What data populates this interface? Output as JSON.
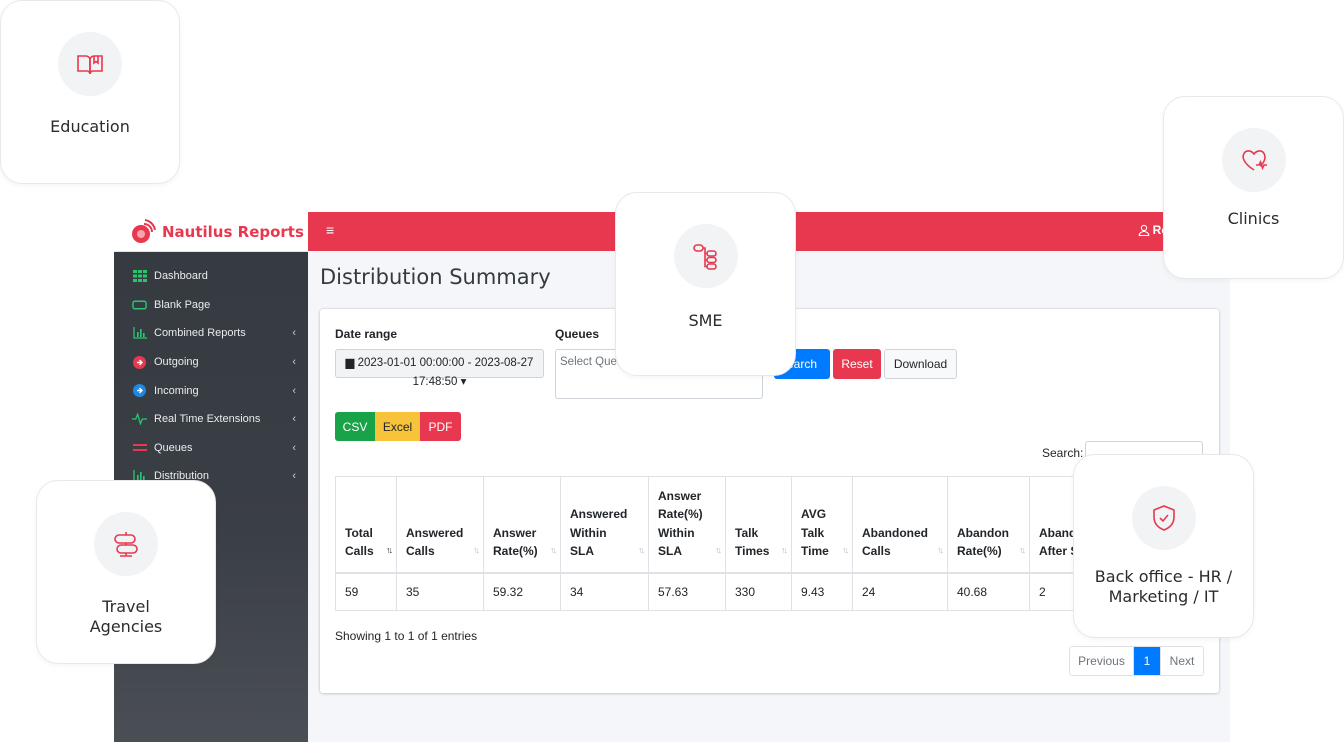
{
  "brand": {
    "name": "Nautilus Reports"
  },
  "colors": {
    "accent": "#e8384f",
    "primary": "#007bff",
    "success": "#18a349",
    "warning": "#f7c33a",
    "sidebar": "#343a40"
  },
  "sidebar": {
    "items": [
      {
        "label": "Dashboard",
        "icon": "grid-icon",
        "chevron": ""
      },
      {
        "label": "Blank Page",
        "icon": "rectangle-icon",
        "chevron": ""
      },
      {
        "label": "Combined Reports",
        "icon": "bar-chart-icon",
        "chevron": "‹"
      },
      {
        "label": "Outgoing",
        "icon": "arrow-circle-icon",
        "chevron": "‹"
      },
      {
        "label": "Incoming",
        "icon": "arrow-circle-icon",
        "chevron": "‹"
      },
      {
        "label": "Real Time Extensions",
        "icon": "pulse-icon",
        "chevron": "‹"
      },
      {
        "label": "Queues",
        "icon": "equals-icon",
        "chevron": "‹"
      },
      {
        "label": "Distribution",
        "icon": "bar-chart-icon",
        "chevron": "‹"
      }
    ]
  },
  "topbar": {
    "menu_icon": "≡",
    "user_text": "Re"
  },
  "page": {
    "title": "Distribution Summary"
  },
  "filters": {
    "date_label": "Date range",
    "date_value_line1": "2023-01-01 00:00:00 - 2023-08-27",
    "date_value_line2": "17:48:50",
    "queues_label": "Queues",
    "queues_placeholder": "Select Queu"
  },
  "buttons": {
    "search": "earch",
    "reset": "Reset",
    "download": "Download"
  },
  "export": {
    "csv": "CSV",
    "excel": "Excel",
    "pdf": "PDF"
  },
  "table": {
    "search_label": "Search:",
    "headers": [
      {
        "lines": [
          "Total",
          "Calls"
        ],
        "width": 61,
        "sort": "asc"
      },
      {
        "lines": [
          "Answered",
          "Calls"
        ],
        "width": 87,
        "sort": "none"
      },
      {
        "lines": [
          "Answer",
          "Rate(%)"
        ],
        "width": 77,
        "sort": "none"
      },
      {
        "lines": [
          "Answered",
          "Within",
          "SLA"
        ],
        "width": 88,
        "sort": "none"
      },
      {
        "lines": [
          "Answer",
          "Rate(%)",
          "Within",
          "SLA"
        ],
        "width": 77,
        "sort": "none"
      },
      {
        "lines": [
          "Talk",
          "Times"
        ],
        "width": 66,
        "sort": "none"
      },
      {
        "lines": [
          "AVG",
          "Talk",
          "Time"
        ],
        "width": 61,
        "sort": "none"
      },
      {
        "lines": [
          "Abandoned",
          "Calls"
        ],
        "width": 95,
        "sort": "none"
      },
      {
        "lines": [
          "Abandon",
          "Rate(%)"
        ],
        "width": 82,
        "sort": "none"
      },
      {
        "lines": [
          "Aband",
          "After S"
        ],
        "width": 60,
        "sort": "none"
      }
    ],
    "rows": [
      [
        "59",
        "35",
        "59.32",
        "34",
        "57.63",
        "330",
        "9.43",
        "24",
        "40.68",
        "2"
      ]
    ],
    "showing": "Showing 1 to 1 of 1 entries"
  },
  "pagination": {
    "previous": "Previous",
    "current": "1",
    "next": "Next"
  },
  "tiles": {
    "education": "Education",
    "sme": "SME",
    "clinics": "Clinics",
    "travel": "Travel\nAgencies",
    "backoffice": "Back office - HR /\nMarketing / IT"
  }
}
